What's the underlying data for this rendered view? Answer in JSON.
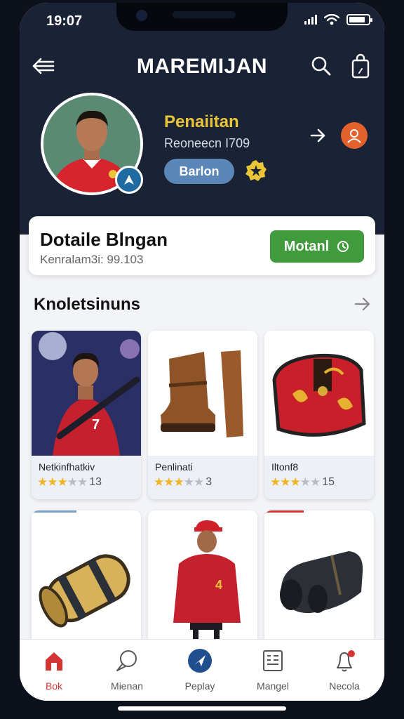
{
  "status_bar": {
    "time": "19:07"
  },
  "header": {
    "title": "MAREMIJAN",
    "icons": {
      "back": "arrow-left-icon",
      "search": "search-icon",
      "bag": "shopping-bag-icon"
    }
  },
  "profile": {
    "name": "Penaiitan",
    "subtitle": "Reoneecn I709",
    "button_label": "Barlon",
    "colors": {
      "name": "#e9c537",
      "button": "#5a86b8",
      "user_button": "#e2612d"
    }
  },
  "summary": {
    "title": "Dotaile Blngan",
    "subtitle": "Kenralam3i: 99.103",
    "button_label": "Motanl",
    "colors": {
      "button": "#3f9b3c"
    }
  },
  "section": {
    "title": "Knoletsinuns"
  },
  "products": [
    {
      "name": "Netkinfhatkiv",
      "rating": 3,
      "count": "13"
    },
    {
      "name": "Penlinati",
      "rating": 3,
      "count": "3"
    },
    {
      "name": "Iltonf8",
      "rating": 3,
      "count": "15"
    }
  ],
  "bottom_nav": [
    {
      "label": "Bok",
      "icon": "home-icon",
      "active": true
    },
    {
      "label": "Mienan",
      "icon": "chat-icon",
      "active": false
    },
    {
      "label": "Peplay",
      "icon": "navigate-icon",
      "active": false
    },
    {
      "label": "Mangel",
      "icon": "document-icon",
      "active": false
    },
    {
      "label": "Necola",
      "icon": "bell-icon",
      "active": false
    }
  ]
}
